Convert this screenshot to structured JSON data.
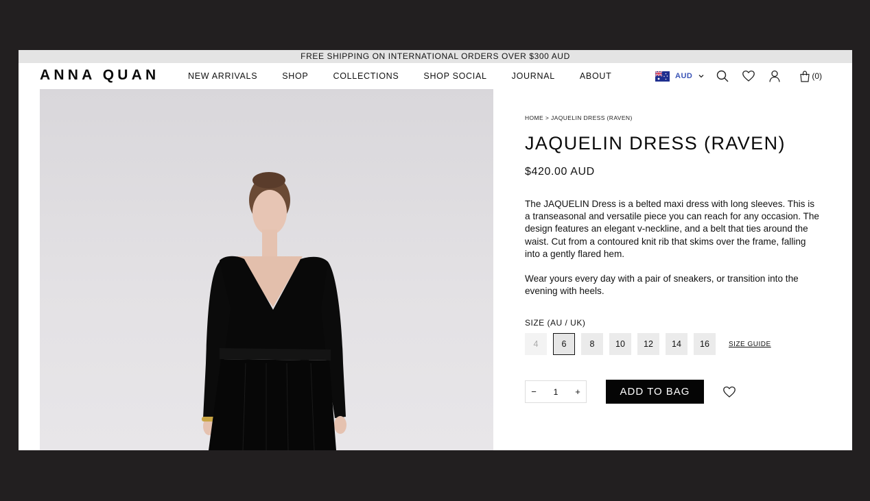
{
  "announcement": "FREE SHIPPING ON INTERNATIONAL ORDERS OVER $300 AUD",
  "brand": "ANNA QUAN",
  "menu": [
    "NEW ARRIVALS",
    "SHOP",
    "COLLECTIONS",
    "SHOP SOCIAL",
    "JOURNAL",
    "ABOUT"
  ],
  "currency": {
    "code": "AUD",
    "flag": "australia-flag-icon"
  },
  "bag_count": "(0)",
  "breadcrumb": "HOME > JAQUELIN DRESS (RAVEN)",
  "product": {
    "title": "JAQUELIN DRESS (RAVEN)",
    "price": "$420.00 AUD",
    "description": [
      "The JAQUELIN Dress is a belted maxi dress with long sleeves. This is a transeasonal and versatile piece you can reach for any occasion. The design features an elegant v-neckline, and a belt that ties around the waist. Cut from a contoured knit rib that skims over the frame, falling into a gently flared hem.",
      "Wear yours every day with a pair of sneakers, or transition into the evening with heels."
    ],
    "size_label": "SIZE (AU / UK)",
    "sizes": [
      "4",
      "6",
      "8",
      "10",
      "12",
      "14",
      "16"
    ],
    "selected_size": "6",
    "unavailable_sizes": [
      "4"
    ],
    "size_guide": "SIZE GUIDE",
    "quantity": "1",
    "add_to_bag": "ADD TO BAG"
  },
  "icons": {
    "search": "search-icon",
    "wishlist": "heart-icon",
    "account": "user-icon",
    "bag": "bag-icon"
  },
  "colors": {
    "button": "#050505",
    "currency_text": "#3a54b6"
  }
}
